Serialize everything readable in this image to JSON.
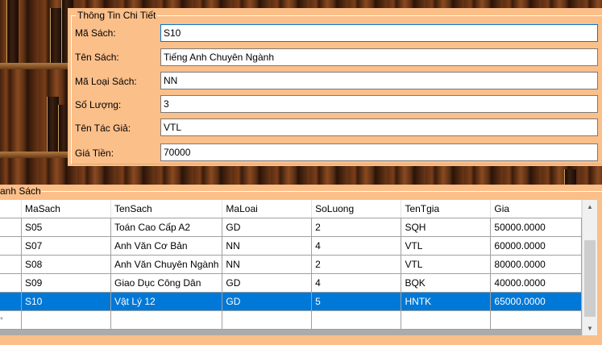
{
  "details": {
    "legend": "Thông Tin Chi Tiết",
    "fields": [
      {
        "label": "Mã Sách:",
        "value": "S10"
      },
      {
        "label": "Tên Sách:",
        "value": "Tiếng Anh Chuyên Ngành"
      },
      {
        "label": "Mã Loại Sách:",
        "value": "NN"
      },
      {
        "label": "Số Lượng:",
        "value": "3"
      },
      {
        "label": "Tên Tác Giả:",
        "value": "VTL"
      },
      {
        "label": "Giá Tiền:",
        "value": "70000"
      }
    ]
  },
  "list": {
    "legend": "anh Sách",
    "columns": [
      "MaSach",
      "TenSach",
      "MaLoai",
      "SoLuong",
      "TenTgia",
      "Gia"
    ],
    "rows": [
      [
        "S05",
        "Toán Cao Cấp A2",
        "GD",
        "2",
        "SQH",
        "50000.0000"
      ],
      [
        "S07",
        "Anh Văn Cơ Bản",
        "NN",
        "4",
        "VTL",
        "60000.0000"
      ],
      [
        "S08",
        "Anh Văn Chuyên Ngành",
        "NN",
        "2",
        "VTL",
        "80000.0000"
      ],
      [
        "S09",
        "Giao Dục Công Dân",
        "GD",
        "4",
        "BQK",
        "40000.0000"
      ],
      [
        "S10",
        "Vật Lý 12",
        "GD",
        "5",
        "HNTK",
        "65000.0000"
      ]
    ],
    "selected_row": 4,
    "new_row_marker": "*"
  },
  "scrollbar": {
    "up_icon": "▲",
    "down_icon": "▼"
  },
  "colors": {
    "panel": "#fbbf8a",
    "selection": "#0078d7"
  }
}
